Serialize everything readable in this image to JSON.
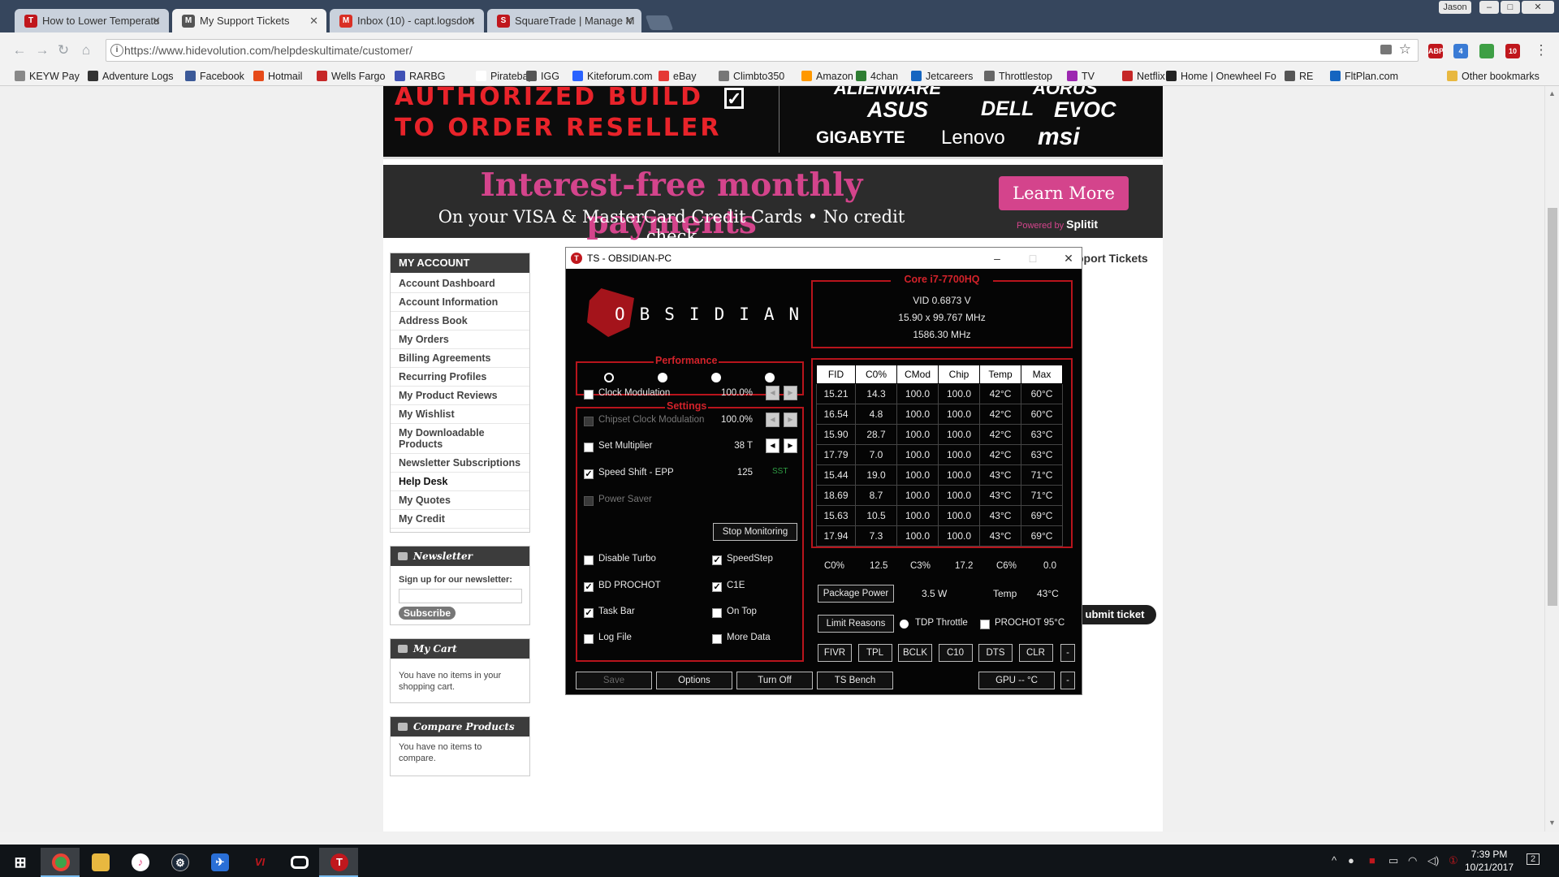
{
  "browser": {
    "tabs": [
      {
        "title": "How to Lower Temperatu",
        "fav_color": "#c0171d"
      },
      {
        "title": "My Support Tickets",
        "fav_color": "#555555"
      },
      {
        "title": "Inbox (10) - capt.logsdon",
        "fav_color": "#d93025"
      },
      {
        "title": "SquareTrade | Manage M",
        "fav_color": "#c0171d"
      }
    ],
    "user": "Jason",
    "window_controls": [
      "–",
      "□",
      "✕"
    ],
    "url": "https://www.hidevolution.com/helpdeskultimate/customer/",
    "bookmarks": [
      "KEYW Pay",
      "Adventure Logs",
      "Facebook",
      "Hotmail",
      "Wells Fargo",
      "RARBG",
      "Piratebay",
      "IGG",
      "Kiteforum.com",
      "eBay",
      "Climbto350",
      "Amazon",
      "4chan",
      "Jetcareers",
      "Throttlestop",
      "TV",
      "Netflix",
      "Home | Onewheel Fo",
      "RE",
      "FltPlan.com"
    ],
    "other_bookmarks": "Other bookmarks"
  },
  "banner": {
    "line1": "AUTHORIZED BUILD",
    "line2": "TO ORDER RESELLER",
    "brands_row1": [
      "ALIENWARE",
      "AORUS"
    ],
    "brands_row2": [
      "ASUS",
      "DELL",
      "EVOC"
    ],
    "brands_row3": [
      "GIGABYTE",
      "Lenovo",
      "msi"
    ]
  },
  "promo": {
    "headline": "Interest-free monthly payments",
    "subline": "On your VISA & MasterCard Credit Cards • No credit check",
    "button": "Learn More",
    "powered_prefix": "Powered by",
    "powered_brand": "Splitit"
  },
  "sidebar": {
    "account_title": "MY ACCOUNT",
    "links": [
      "Account Dashboard",
      "Account Information",
      "Address Book",
      "My Orders",
      "Billing Agreements",
      "Recurring Profiles",
      "My Product Reviews",
      "My Wishlist",
      "My Downloadable Products",
      "Newsletter Subscriptions",
      "Help Desk",
      "My Quotes",
      "My Credit"
    ],
    "active_link": "Help Desk",
    "newsletter_title": "Newsletter",
    "newsletter_text": "Sign up for our newsletter:",
    "subscribe": "Subscribe",
    "cart_title": "My Cart",
    "cart_text": "You have no items in your shopping cart.",
    "compare_title": "Compare Products",
    "compare_text": "You have no items to compare."
  },
  "main": {
    "heading_partial": "pport Tickets",
    "submit_partial": "ubmit ticket"
  },
  "throttlestop": {
    "title": "TS - OBSIDIAN-PC",
    "logo": "OBSIDIAN",
    "cpu": {
      "name": "Core i7-7700HQ",
      "vid": "VID  0.6873 V",
      "mult": "15.90 x 99.767 MHz",
      "freq": "1586.30 MHz"
    },
    "performance_label": "Performance",
    "settings_label": "Settings",
    "settings": [
      {
        "label": "Clock Modulation",
        "checked": false,
        "value": "100.0%",
        "disabled": false
      },
      {
        "label": "Chipset Clock Modulation",
        "checked": false,
        "value": "100.0%",
        "disabled": true
      },
      {
        "label": "Set Multiplier",
        "checked": false,
        "value": "38 T",
        "disabled": false
      },
      {
        "label": "Speed Shift - EPP",
        "checked": true,
        "value": "125",
        "extra": "SST",
        "disabled": false
      },
      {
        "label": "Power Saver",
        "checked": false,
        "disabled": true
      }
    ],
    "stop_monitoring": "Stop Monitoring",
    "toggles_left": [
      {
        "label": "Disable Turbo",
        "checked": false
      },
      {
        "label": "BD PROCHOT",
        "checked": true
      },
      {
        "label": "Task Bar",
        "checked": true
      },
      {
        "label": "Log File",
        "checked": false
      }
    ],
    "toggles_right": [
      {
        "label": "SpeedStep",
        "checked": true
      },
      {
        "label": "C1E",
        "checked": true
      },
      {
        "label": "On Top",
        "checked": false
      },
      {
        "label": "More Data",
        "checked": false
      }
    ],
    "table": {
      "headers": [
        "FID",
        "C0%",
        "CMod",
        "Chip",
        "Temp",
        "Max"
      ],
      "rows": [
        [
          "15.21",
          "14.3",
          "100.0",
          "100.0",
          "42°C",
          "60°C"
        ],
        [
          "16.54",
          "4.8",
          "100.0",
          "100.0",
          "42°C",
          "60°C"
        ],
        [
          "15.90",
          "28.7",
          "100.0",
          "100.0",
          "42°C",
          "63°C"
        ],
        [
          "17.79",
          "7.0",
          "100.0",
          "100.0",
          "42°C",
          "63°C"
        ],
        [
          "15.44",
          "19.0",
          "100.0",
          "100.0",
          "43°C",
          "71°C"
        ],
        [
          "18.69",
          "8.7",
          "100.0",
          "100.0",
          "43°C",
          "71°C"
        ],
        [
          "15.63",
          "10.5",
          "100.0",
          "100.0",
          "43°C",
          "69°C"
        ],
        [
          "17.94",
          "7.3",
          "100.0",
          "100.0",
          "43°C",
          "69°C"
        ]
      ]
    },
    "cstates": {
      "c0_label": "C0%",
      "c0": "12.5",
      "c3_label": "C3%",
      "c3": "17.2",
      "c6_label": "C6%",
      "c6": "0.0"
    },
    "package_power_btn": "Package Power",
    "package_power": "3.5 W",
    "temp_label": "Temp",
    "temp": "43°C",
    "limit_reasons": "Limit Reasons",
    "tdp_throttle": "TDP Throttle",
    "prochot95": "PROCHOT 95°C",
    "small_buttons": [
      "FIVR",
      "TPL",
      "BCLK",
      "C10",
      "DTS",
      "CLR",
      "-"
    ],
    "bottom_buttons": [
      "Save",
      "Options",
      "Turn Off",
      "TS Bench"
    ],
    "gpu": "GPU -- °C",
    "minus": "-"
  },
  "taskbar": {
    "time": "7:39 PM",
    "date": "10/21/2017",
    "notif_count": "2"
  }
}
